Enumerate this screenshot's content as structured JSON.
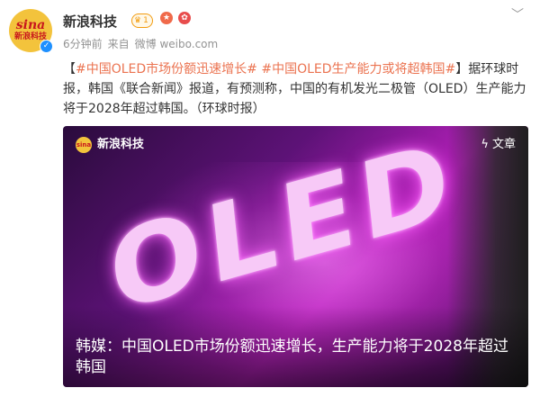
{
  "account": {
    "avatar_logo_top": "sina",
    "avatar_logo_bottom": "新浪科技",
    "name": "新浪科技",
    "level": "1",
    "timestamp": "6分钟前",
    "source_prefix": "来自",
    "source": "微博 weibo.com"
  },
  "post": {
    "bracket_open": "【",
    "hashtag1": "#中国OLED市场份额迅速增长#",
    "hashtag2": "#中国OLED生产能力或将超韩国#",
    "bracket_close": "】",
    "body": "据环球时报，韩国《联合新闻》报道，有预测称，中国的有机发光二极管（OLED）生产能力将于2028年超过韩国。（环球时报）"
  },
  "media": {
    "source_avatar": "sina",
    "source_name": "新浪科技",
    "tag_icon": "lightning-icon",
    "tag_label": "文章",
    "image_text": "OLED",
    "headline": "韩媒：中国OLED市场份额迅速增长，生产能力将于2028年超过韩国"
  },
  "colors": {
    "hashtag": "#eb7350",
    "brand_yellow": "#f3c33c",
    "brand_red": "#c8161d",
    "verify_blue": "#1e90ff"
  }
}
